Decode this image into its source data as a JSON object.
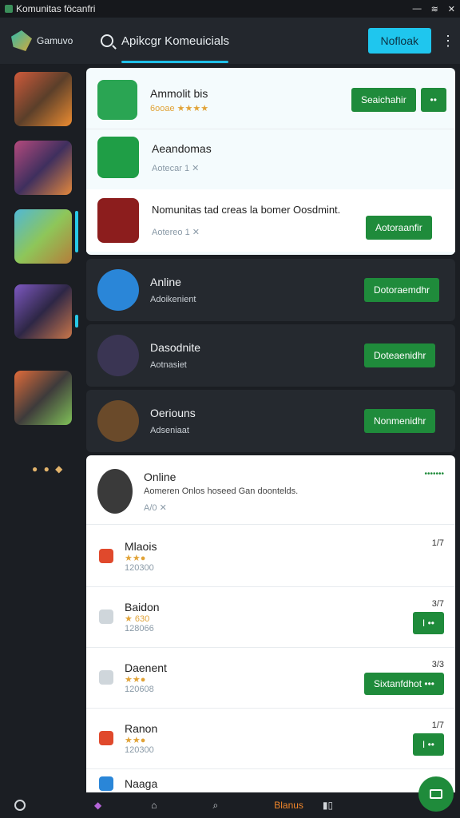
{
  "titlebar": {
    "title": "Komunitas föcanfri"
  },
  "header": {
    "app_name": "Gamuvo",
    "search_text": "Apikcgr Komeuicials",
    "primary_button": "Nofloak"
  },
  "featured": [
    {
      "title": "Ammolit bis",
      "subtitle": "6ooae ★★★★",
      "button": "Seaichahir",
      "icon_color": "#2aa553"
    },
    {
      "title": "Aeandomas",
      "subtitle": "Aotecar 1 ✕",
      "icon_color": "#1f9e46"
    },
    {
      "title": "Nomunitas tad creas la bomer Oosdmint.",
      "subtitle": "Aotereo 1 ✕",
      "button": "Aotoraanfir",
      "icon_color": "#8c1d1d"
    }
  ],
  "dark_list": [
    {
      "title": "Anline",
      "subtitle": "Adoikenient",
      "button": "Dotoraemdhr",
      "icon_color": "#2a86d8"
    },
    {
      "title": "Dasodnite",
      "subtitle": "Aotnasiet",
      "button": "Doteaenidhr",
      "icon_color": "#3a3553"
    },
    {
      "title": "Oeriouns",
      "subtitle": "Adseniaat",
      "button": "Nonmenidhr",
      "icon_color": "#6a4a2a"
    }
  ],
  "profile_card": {
    "title": "Online",
    "desc": "Aomeren Onlos hoseed Gan doontelds.",
    "meta": "A/0 ✕",
    "more": "•••••••"
  },
  "list": [
    {
      "name": "Mlaois",
      "rating": "★★●",
      "count": "120300",
      "num": "1/7",
      "badge": "#e0492c"
    },
    {
      "name": "Baidon",
      "rating": "★ 630",
      "count": "128066",
      "num": "3/7",
      "badge": "#cfd6db",
      "btn": "I ••"
    },
    {
      "name": "Daenent",
      "rating": "★★●",
      "count": "120608",
      "num": "3/3",
      "badge": "#cfd6db",
      "btn": "Sixtanfdhot •••"
    },
    {
      "name": "Ranon",
      "rating": "★★●",
      "count": "120300",
      "num": "1/7",
      "badge": "#e0492c",
      "btn": "I ••"
    },
    {
      "name": "Naaga",
      "rating": "",
      "count": "",
      "num": "",
      "badge": "#2a86d8"
    }
  ],
  "footer": {
    "tab_label": "Blanus"
  }
}
